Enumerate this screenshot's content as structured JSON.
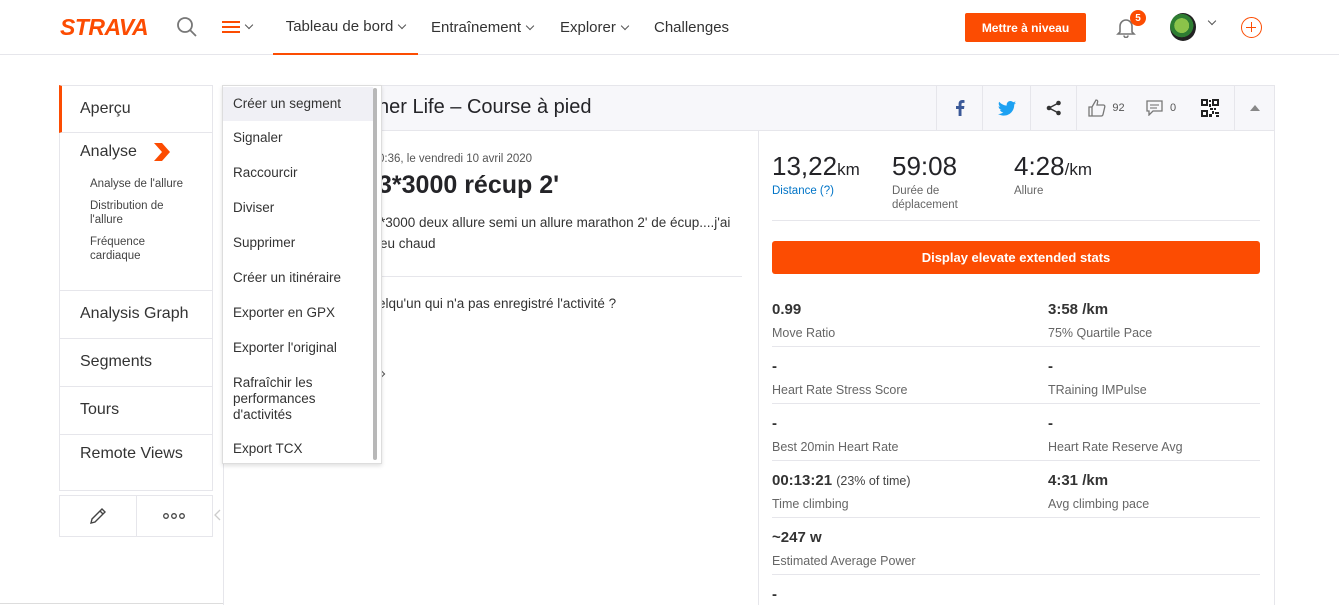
{
  "brand": {
    "logo": "STRAVA",
    "accent": "#fc4c02"
  },
  "nav": {
    "dashboard": "Tableau de bord",
    "training": "Entraînement",
    "explore": "Explorer",
    "challenges": "Challenges",
    "upgrade": "Mettre à niveau",
    "notif_count": "5"
  },
  "sidebar": {
    "overview": "Aperçu",
    "analysis": "Analyse",
    "analysis_sub": [
      "Analyse de l'allure",
      "Distribution de l'allure",
      "Fréquence cardiaque"
    ],
    "graph": "Analysis Graph",
    "segments": "Segments",
    "tours": "Tours",
    "remote": "Remote Views"
  },
  "dropdown": {
    "items": [
      "Créer un segment",
      "Signaler",
      "Raccourcir",
      "Diviser",
      "Supprimer",
      "Créer un itinéraire",
      "Exporter en GPX",
      "Exporter l'original",
      "Rafraîchir les performances d'activités",
      "Export TCX"
    ]
  },
  "activity": {
    "title_visible": "her Life – Course à pied",
    "date_visible": "0:36, le vendredi 10 avril 2020",
    "name_visible": "3*3000 récup 2'",
    "desc_visible": "*3000 deux allure semi un allure marathon 2' de écup....j'ai eu chaud",
    "comment_visible": "elqu'un qui n'a pas enregistré l'activité ?",
    "likes": "92",
    "comments": "0"
  },
  "stats": {
    "distance": {
      "value": "13,22",
      "unit": "km",
      "label": "Distance (?)"
    },
    "moving_time": {
      "value": "59:08",
      "label": "Durée de déplacement"
    },
    "pace": {
      "value": "4:28",
      "unit": "/km",
      "label": "Allure"
    }
  },
  "elevate": {
    "button": "Display elevate extended stats",
    "rows": [
      {
        "left_val": "0.99",
        "left_lbl": "Move Ratio",
        "right_val": "3:58 /km",
        "right_lbl": "75% Quartile Pace"
      },
      {
        "left_val": "-",
        "left_lbl": "Heart Rate Stress Score",
        "right_val": "-",
        "right_lbl": "TRaining IMPulse"
      },
      {
        "left_val": "-",
        "left_lbl": "Best 20min Heart Rate",
        "right_val": "-",
        "right_lbl": "Heart Rate Reserve Avg"
      },
      {
        "left_val": "00:13:21",
        "left_paren": "(23% of time)",
        "left_lbl": "Time climbing",
        "right_val": "4:31 /km",
        "right_lbl": "Avg climbing pace"
      },
      {
        "left_val": "~247 w",
        "left_lbl": "Estimated Average Power",
        "right_val": "",
        "right_lbl": ""
      }
    ],
    "tail": "-"
  }
}
